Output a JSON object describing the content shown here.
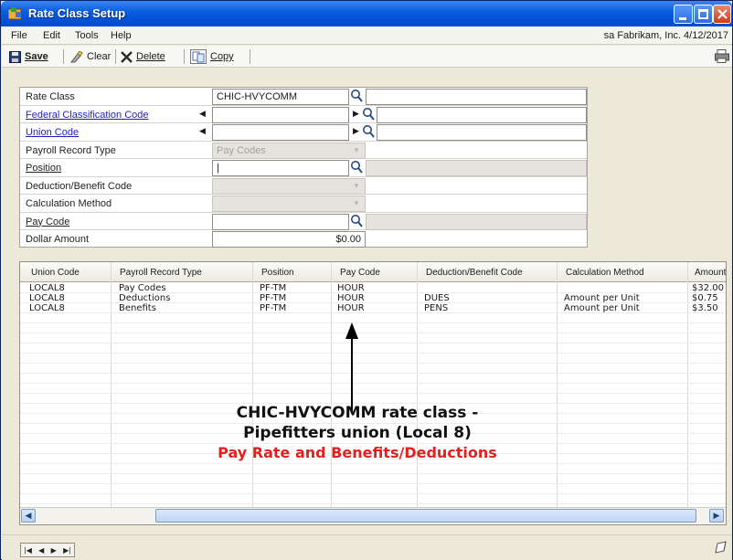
{
  "window": {
    "title": "Rate Class Setup"
  },
  "menubar": {
    "items": [
      "File",
      "Edit",
      "Tools",
      "Help"
    ],
    "company_info": "sa Fabrikam, Inc. 4/12/2017"
  },
  "toolbar": {
    "save_label": "Save",
    "clear_label": "Clear",
    "delete_label": "Delete",
    "copy_label": "Copy"
  },
  "form": {
    "rate_class": {
      "label": "Rate Class",
      "value": "CHIC-HVYCOMM",
      "description": ""
    },
    "federal_classification_code": {
      "label": "Federal Classification Code",
      "value": "",
      "description": ""
    },
    "union_code": {
      "label": "Union Code",
      "value": "",
      "description": ""
    },
    "payroll_record_type": {
      "label": "Payroll Record Type",
      "value": "Pay Codes"
    },
    "position": {
      "label": "Position",
      "value": "|",
      "description": ""
    },
    "deduction_benefit_code": {
      "label": "Deduction/Benefit Code",
      "value": ""
    },
    "calculation_method": {
      "label": "Calculation Method",
      "value": ""
    },
    "pay_code": {
      "label": "Pay Code",
      "value": "",
      "description": ""
    },
    "dollar_amount": {
      "label": "Dollar Amount",
      "value": "$0.00"
    }
  },
  "grid": {
    "columns": [
      "Union Code",
      "Payroll Record Type",
      "Position",
      "Pay Code",
      "Deduction/Benefit Code",
      "Calculation Method",
      "Amount"
    ],
    "rows": [
      [
        "LOCAL8",
        "Pay Codes",
        "PF-TM",
        "HOUR",
        "",
        "",
        "$32.00"
      ],
      [
        "LOCAL8",
        "Deductions",
        "PF-TM",
        "HOUR",
        "DUES",
        "Amount per Unit",
        "$0.75"
      ],
      [
        "LOCAL8",
        "Benefits",
        "PF-TM",
        "HOUR",
        "PENS",
        "Amount per Unit",
        "$3.50"
      ]
    ]
  },
  "annotation": {
    "line1": "CHIC-HVYCOMM rate class -",
    "line2": "Pipefitters union (Local 8)",
    "line3": "Pay Rate and Benefits/Deductions",
    "line3_color": "#e4201f"
  },
  "colors": {
    "titlebar": "#0a5fe0",
    "link": "#1d1dc8",
    "window_bg": "#ece9d8"
  },
  "icons": [
    "window-app-icon",
    "minimize-icon",
    "maximize-icon",
    "close-icon",
    "save-icon",
    "clear-icon",
    "delete-icon",
    "copy-icon",
    "print-icon",
    "lookup-icon",
    "arrow-left-icon",
    "arrow-right-icon",
    "first-record-icon",
    "previous-record-icon",
    "next-record-icon",
    "last-record-icon",
    "note-icon"
  ]
}
